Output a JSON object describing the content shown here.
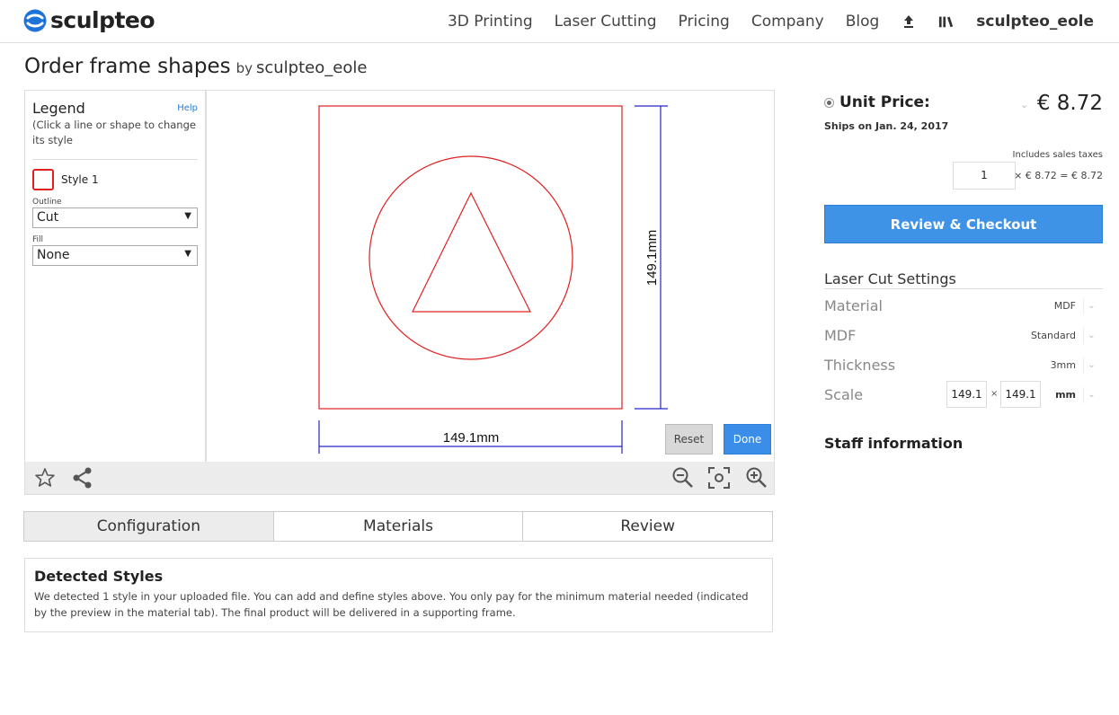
{
  "brand": {
    "name": "sculpteo",
    "color": "#1e73d8"
  },
  "nav": {
    "items": [
      "3D Printing",
      "Laser Cutting",
      "Pricing",
      "Company",
      "Blog"
    ],
    "icons": [
      "upload-icon",
      "library-icon"
    ],
    "user": "sculpteo_eole"
  },
  "page": {
    "title": "Order frame shapes",
    "by": "by",
    "author": "sculpteo_eole"
  },
  "legend": {
    "title": "Legend",
    "help": "Help",
    "description": "(Click a line or shape to change its style",
    "style_name": "Style 1",
    "style_color": "#e02020",
    "outline_label": "Outline",
    "outline_value": "Cut",
    "fill_label": "Fill",
    "fill_value": "None"
  },
  "canvas": {
    "width_label": "149.1mm",
    "height_label": "149.1mm",
    "cut_color": "#e02020",
    "dimension_color": "#2424c8"
  },
  "buttons": {
    "reset": "Reset",
    "done": "Done",
    "checkout": "Review & Checkout"
  },
  "toolbar": {
    "icons": [
      "star-icon",
      "share-icon",
      "zoom-out-icon",
      "fit-view-icon",
      "zoom-in-icon"
    ]
  },
  "tabs": [
    {
      "label": "Configuration",
      "active": true
    },
    {
      "label": "Materials",
      "active": false
    },
    {
      "label": "Review",
      "active": false
    }
  ],
  "detected": {
    "title": "Detected Styles",
    "text": "We detected 1 style in your uploaded file. You can add and define styles above. You only pay for the minimum material needed (indicated by the preview in the material tab). The final product will be delivered in a supporting frame."
  },
  "pricing": {
    "unit_label": "Unit Price:",
    "unit_price": "€ 8.72",
    "ships": "Ships on Jan. 24, 2017",
    "taxes": "Includes sales taxes",
    "quantity": "1",
    "calc": "× € 8.72 = € 8.72"
  },
  "settings": {
    "title": "Laser Cut Settings",
    "rows": [
      {
        "label": "Material",
        "value": "MDF"
      },
      {
        "label": "MDF",
        "value": "Standard"
      },
      {
        "label": "Thickness",
        "value": "3mm"
      }
    ],
    "scale_label": "Scale",
    "scale_x": "149.1",
    "scale_sep": "×",
    "scale_y": "149.1",
    "scale_unit": "mm"
  },
  "staff": {
    "title": "Staff information"
  }
}
